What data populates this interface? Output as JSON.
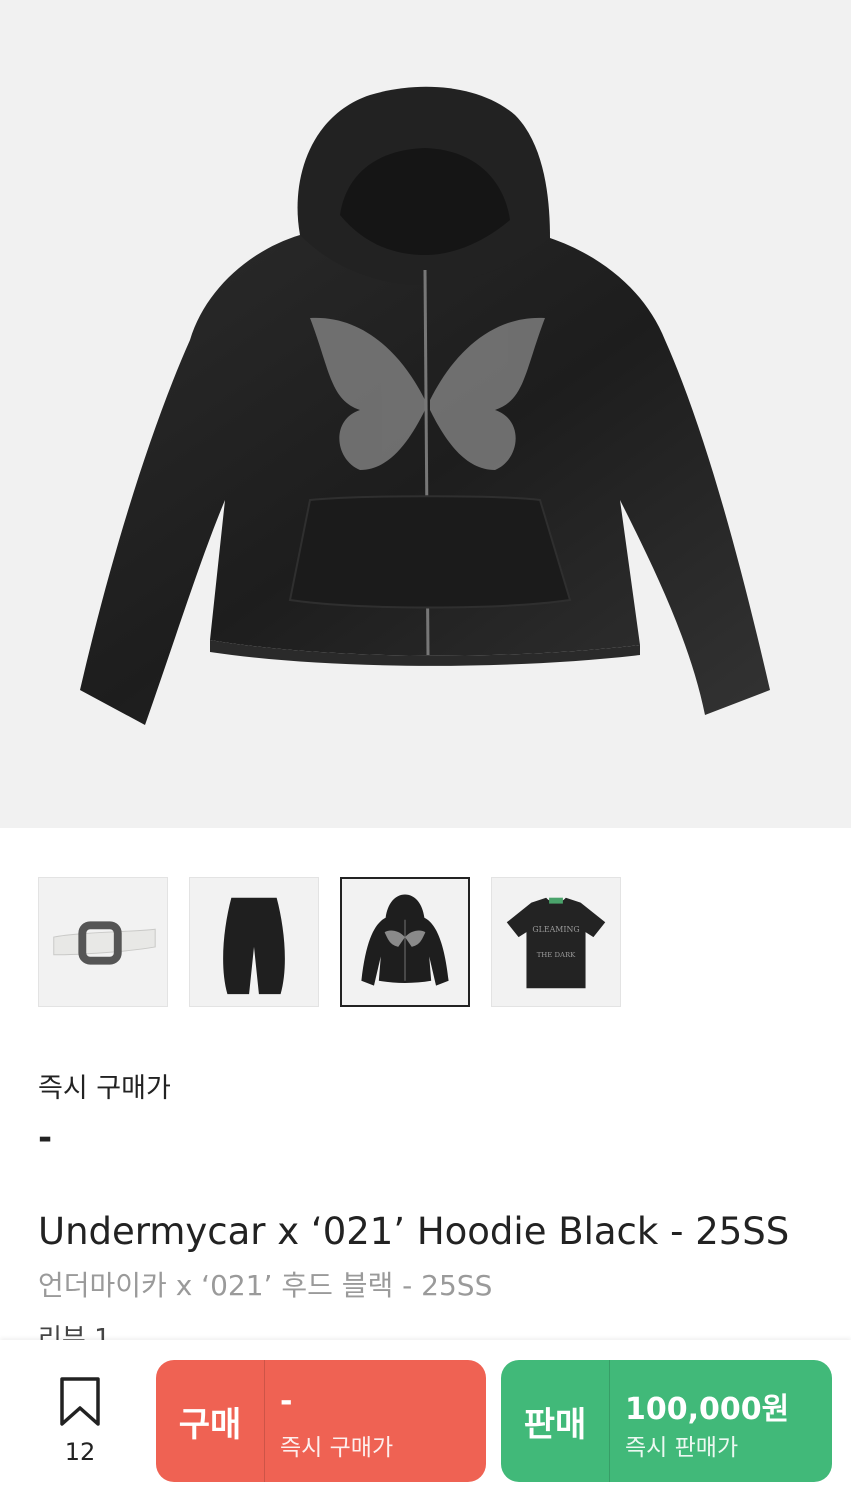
{
  "product": {
    "image_alt": "black distressed zip-up hoodie with butterfly graphic",
    "title_en": "Undermycar x ‘021’ Hoodie Black - 25SS",
    "title_ko": "언더마이카 x ‘021’ 후드 블랙 - 25SS",
    "review_label": "리뷰 1"
  },
  "thumbnails": [
    {
      "name": "belt",
      "icon": "belt-thumbnail",
      "selected": false
    },
    {
      "name": "pants",
      "icon": "pants-thumbnail",
      "selected": false
    },
    {
      "name": "hoodie",
      "icon": "hoodie-thumbnail",
      "selected": true
    },
    {
      "name": "tshirt",
      "icon": "tshirt-thumbnail",
      "selected": false
    }
  ],
  "price": {
    "label": "즉시 구매가",
    "value": "-"
  },
  "bottom_bar": {
    "bookmark_icon": "bookmark-icon",
    "bookmark_count": "12",
    "buy": {
      "label": "구매",
      "price": "-",
      "sub_label": "즉시 구매가",
      "color": "#ef6253"
    },
    "sell": {
      "label": "판매",
      "price": "100,000원",
      "sub_label": "즉시 판매가",
      "color": "#41b979"
    }
  }
}
